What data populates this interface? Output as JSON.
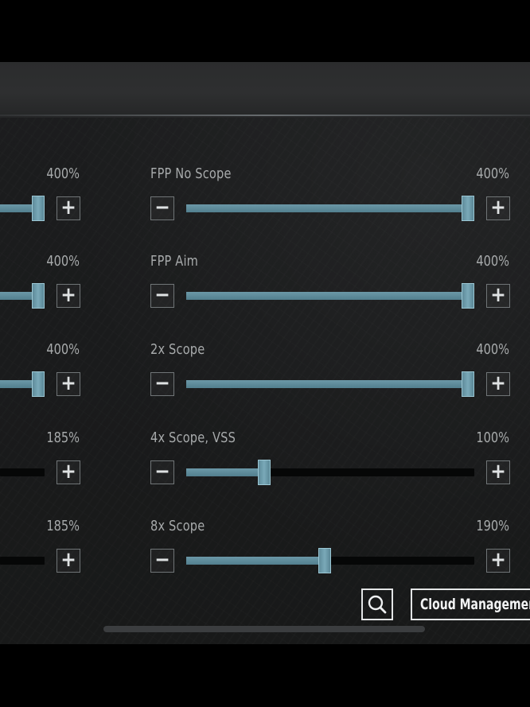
{
  "left_column": {
    "rows": [
      {
        "value": "400%",
        "level_percent": 100
      },
      {
        "value": "400%",
        "level_percent": 100
      },
      {
        "value": "400%",
        "level_percent": 100
      },
      {
        "value": "185%",
        "level_percent": 0
      },
      {
        "value": "185%",
        "level_percent": 0
      }
    ]
  },
  "right_column": {
    "rows": [
      {
        "label": "FPP No Scope",
        "value": "400%",
        "level_percent": 100
      },
      {
        "label": "FPP Aim",
        "value": "400%",
        "level_percent": 100
      },
      {
        "label": "2x Scope",
        "value": "400%",
        "level_percent": 100
      },
      {
        "label": "4x Scope, VSS",
        "value": "100%",
        "level_percent": 26
      },
      {
        "label": "8x Scope",
        "value": "190%",
        "level_percent": 48
      }
    ]
  },
  "buttons": {
    "minus": "−",
    "plus": "+"
  },
  "footer": {
    "cloud_label": "Cloud Management"
  },
  "colors": {
    "slider_fill": "#5f8c9b",
    "track": "#060707",
    "background": "#1b1c1d"
  }
}
